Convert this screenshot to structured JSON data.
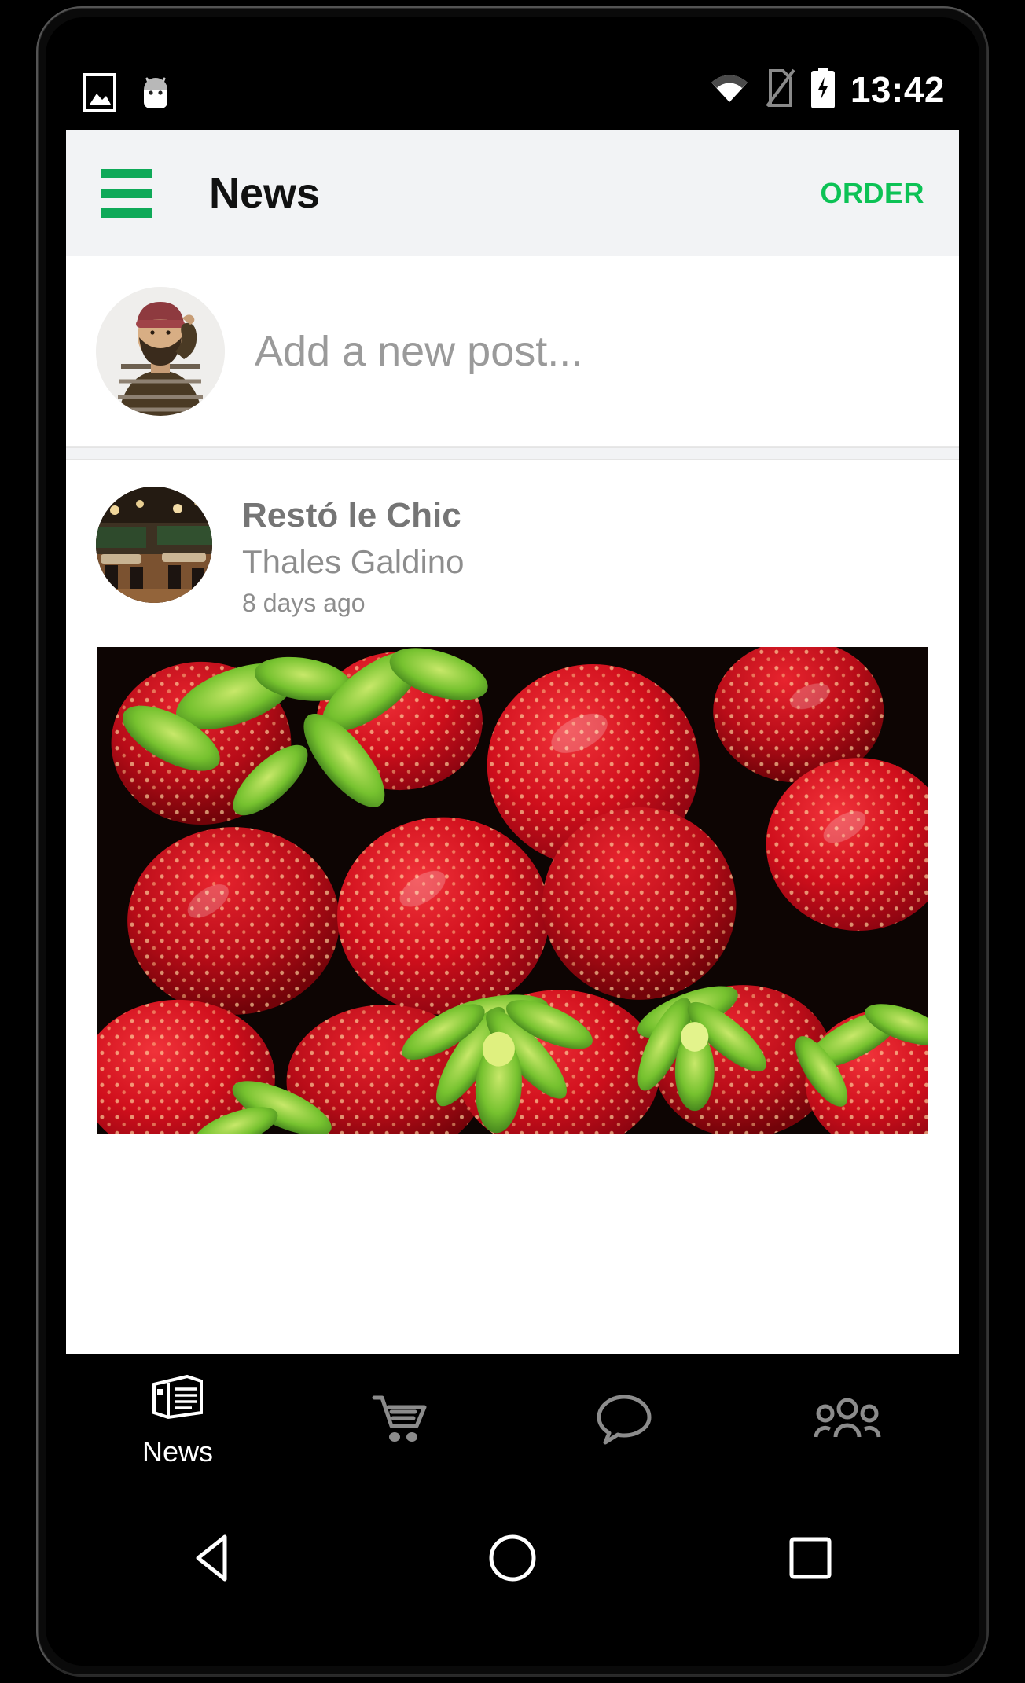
{
  "status_bar": {
    "time": "13:42",
    "icons_left": [
      "image-icon",
      "android-head-icon"
    ],
    "icons_right": [
      "wifi-icon",
      "sim-missing-icon",
      "battery-charging-icon"
    ]
  },
  "app_bar": {
    "menu_icon": "hamburger-menu-icon",
    "title": "News",
    "action_label": "ORDER",
    "accent_color": "#0cc255",
    "background_color": "#f2f3f5"
  },
  "compose": {
    "placeholder": "Add a new post...",
    "avatar_alt": "user-avatar"
  },
  "post": {
    "title": "Restó le Chic",
    "author": "Thales Galdino",
    "timestamp": "8 days ago",
    "photo_alt": "strawberries-photo"
  },
  "bottom_nav": {
    "items": [
      {
        "label": "News",
        "icon": "newspaper-icon",
        "active": true
      },
      {
        "label": "",
        "icon": "shopping-cart-icon",
        "active": false
      },
      {
        "label": "",
        "icon": "chat-bubble-icon",
        "active": false
      },
      {
        "label": "",
        "icon": "people-group-icon",
        "active": false
      }
    ]
  },
  "android_nav": {
    "back": "back-triangle-icon",
    "home": "home-circle-icon",
    "recents": "recents-square-icon"
  }
}
